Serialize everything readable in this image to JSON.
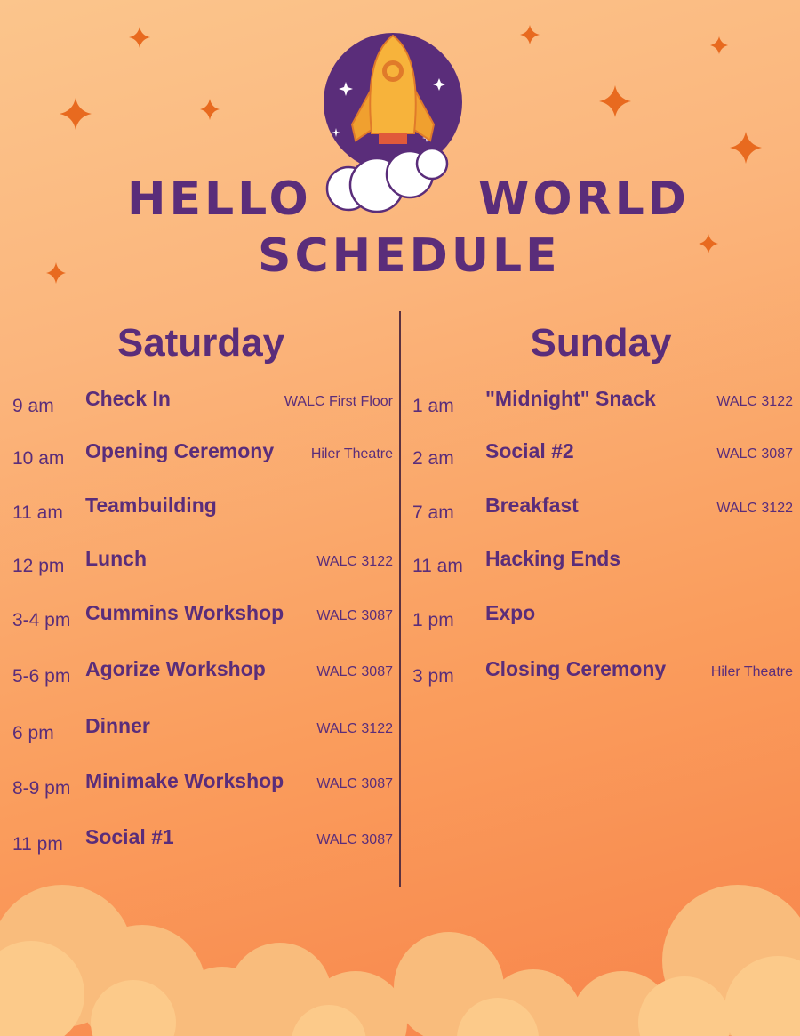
{
  "title": {
    "line1_left": "HELLO",
    "line1_right": "WORLD",
    "line2": "SCHEDULE"
  },
  "colors": {
    "primary_purple": "#5a2d7a",
    "rocket_yellow": "#f7b33b",
    "star_orange": "#e86a1f",
    "cloud_light": "#fcca8a",
    "background_top": "#fbc58c",
    "background_bottom": "#f8844a"
  },
  "icons": [
    "rocket-icon",
    "cloud-icon",
    "star-icon"
  ],
  "saturday": {
    "heading": "Saturday",
    "events": [
      {
        "time": "9 am",
        "event": "Check In",
        "location": "WALC First Floor"
      },
      {
        "time": "10 am",
        "event": "Opening Ceremony",
        "location": "Hiler Theatre"
      },
      {
        "time": "11 am",
        "event": "Teambuilding",
        "location": ""
      },
      {
        "time": "12 pm",
        "event": "Lunch",
        "location": "WALC 3122"
      },
      {
        "time": "3-4 pm",
        "event": "Cummins Workshop",
        "location": "WALC 3087"
      },
      {
        "time": "5-6 pm",
        "event": "Agorize Workshop",
        "location": "WALC 3087"
      },
      {
        "time": "6 pm",
        "event": "Dinner",
        "location": "WALC 3122"
      },
      {
        "time": "8-9 pm",
        "event": "Minimake Workshop",
        "location": "WALC 3087"
      },
      {
        "time": "11 pm",
        "event": "Social #1",
        "location": "WALC 3087"
      }
    ]
  },
  "sunday": {
    "heading": "Sunday",
    "events": [
      {
        "time": "1 am",
        "event": "\"Midnight\" Snack",
        "location": "WALC 3122"
      },
      {
        "time": "2 am",
        "event": "Social #2",
        "location": "WALC 3087"
      },
      {
        "time": "7 am",
        "event": "Breakfast",
        "location": "WALC 3122"
      },
      {
        "time": "11 am",
        "event": "Hacking Ends",
        "location": ""
      },
      {
        "time": "1 pm",
        "event": "Expo",
        "location": ""
      },
      {
        "time": "3 pm",
        "event": "Closing Ceremony",
        "location": "Hiler Theatre"
      }
    ]
  }
}
